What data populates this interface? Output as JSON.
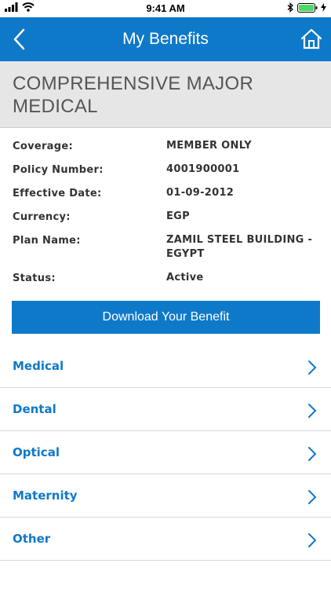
{
  "status_bar": {
    "time": "9:41 AM"
  },
  "nav": {
    "title": "My Benefits",
    "back_icon": "chevron-left-icon",
    "home_icon": "home-icon"
  },
  "plan": {
    "title": "COMPREHENSIVE MAJOR MEDICAL"
  },
  "details": [
    {
      "label": "Coverage:",
      "value": "MEMBER ONLY"
    },
    {
      "label": "Policy Number:",
      "value": "4001900001"
    },
    {
      "label": "Effective Date:",
      "value": "01-09-2012"
    },
    {
      "label": "Currency:",
      "value": "EGP"
    },
    {
      "label": "Plan Name:",
      "value": "ZAMIL STEEL BUILDING - EGYPT"
    },
    {
      "label": "Status:",
      "value": "Active"
    }
  ],
  "download_label": "Download Your Benefit",
  "menu": [
    {
      "label": "Medical"
    },
    {
      "label": "Dental"
    },
    {
      "label": "Optical"
    },
    {
      "label": "Maternity"
    },
    {
      "label": "Other"
    }
  ],
  "colors": {
    "primary": "#0f79c9",
    "header_bg": "#e6e6e6",
    "battery": "#4cd964"
  }
}
